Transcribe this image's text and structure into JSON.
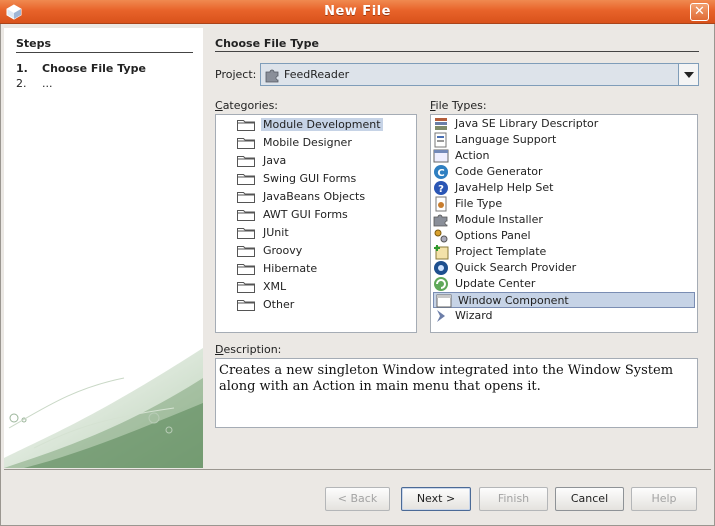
{
  "window": {
    "title": "New File"
  },
  "steps": {
    "heading": "Steps",
    "items": [
      {
        "num": "1.",
        "label": "Choose File Type",
        "current": true
      },
      {
        "num": "2.",
        "label": "...",
        "current": false
      }
    ]
  },
  "main": {
    "heading": "Choose File Type",
    "project_label": "Project:",
    "project_value": "FeedReader",
    "categories_label": "Categories:",
    "file_types_label": "File Types:",
    "categories": [
      "Module Development",
      "Mobile Designer",
      "Java",
      "Swing GUI Forms",
      "JavaBeans Objects",
      "AWT GUI Forms",
      "JUnit",
      "Groovy",
      "Hibernate",
      "XML",
      "Other"
    ],
    "selected_category": "Module Development",
    "file_types": [
      {
        "label": "Java SE Library Descriptor",
        "icon": "library-icon"
      },
      {
        "label": "Language Support",
        "icon": "language-icon"
      },
      {
        "label": "Action",
        "icon": "action-icon"
      },
      {
        "label": "Code Generator",
        "icon": "code-generator-icon"
      },
      {
        "label": "JavaHelp Help Set",
        "icon": "help-icon"
      },
      {
        "label": "File Type",
        "icon": "file-type-icon"
      },
      {
        "label": "Module Installer",
        "icon": "module-installer-icon"
      },
      {
        "label": "Options Panel",
        "icon": "options-icon"
      },
      {
        "label": "Project Template",
        "icon": "project-template-icon"
      },
      {
        "label": "Quick Search Provider",
        "icon": "quick-search-icon"
      },
      {
        "label": "Update Center",
        "icon": "update-center-icon"
      },
      {
        "label": "Window Component",
        "icon": "window-icon"
      },
      {
        "label": "Wizard",
        "icon": "wizard-icon"
      }
    ],
    "selected_file_type": "Window Component",
    "description_label": "Description:",
    "description": "Creates a new singleton Window integrated into the Window System along with an Action in main menu that opens it."
  },
  "buttons": {
    "back": "< Back",
    "next": "Next >",
    "finish": "Finish",
    "cancel": "Cancel",
    "help": "Help"
  }
}
